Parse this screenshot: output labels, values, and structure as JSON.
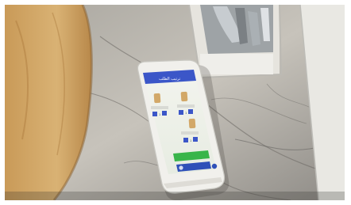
{
  "phone": {
    "header_text": "ترتيب الطلب",
    "items": [
      {
        "name": "",
        "qty": "1"
      },
      {
        "name": "",
        "qty": "1"
      },
      {
        "name": "",
        "qty": "1"
      },
      {
        "name": "",
        "qty": "1"
      }
    ],
    "primary_button": "",
    "secondary_button": ""
  },
  "colors": {
    "phone_header": "#3b56c8",
    "primary_button": "#39b54a",
    "secondary_button": "#2e50b8",
    "bread": "#d2a868",
    "counter": "#bfbcb4"
  }
}
